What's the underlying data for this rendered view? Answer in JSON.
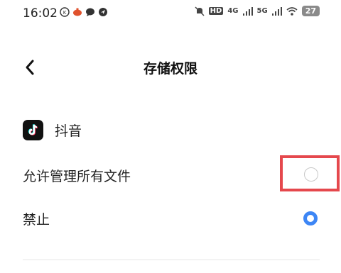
{
  "statusbar": {
    "time": "16:02",
    "network_labels": [
      "HD",
      "4G",
      "5G"
    ],
    "battery": "27"
  },
  "header": {
    "title": "存储权限"
  },
  "app": {
    "name": "抖音",
    "icon": "tiktok-icon"
  },
  "options": [
    {
      "label": "允许管理所有文件",
      "selected": false
    },
    {
      "label": "禁止",
      "selected": true
    }
  ],
  "colors": {
    "accent": "#3d86f5",
    "highlight": "#e5484d"
  }
}
